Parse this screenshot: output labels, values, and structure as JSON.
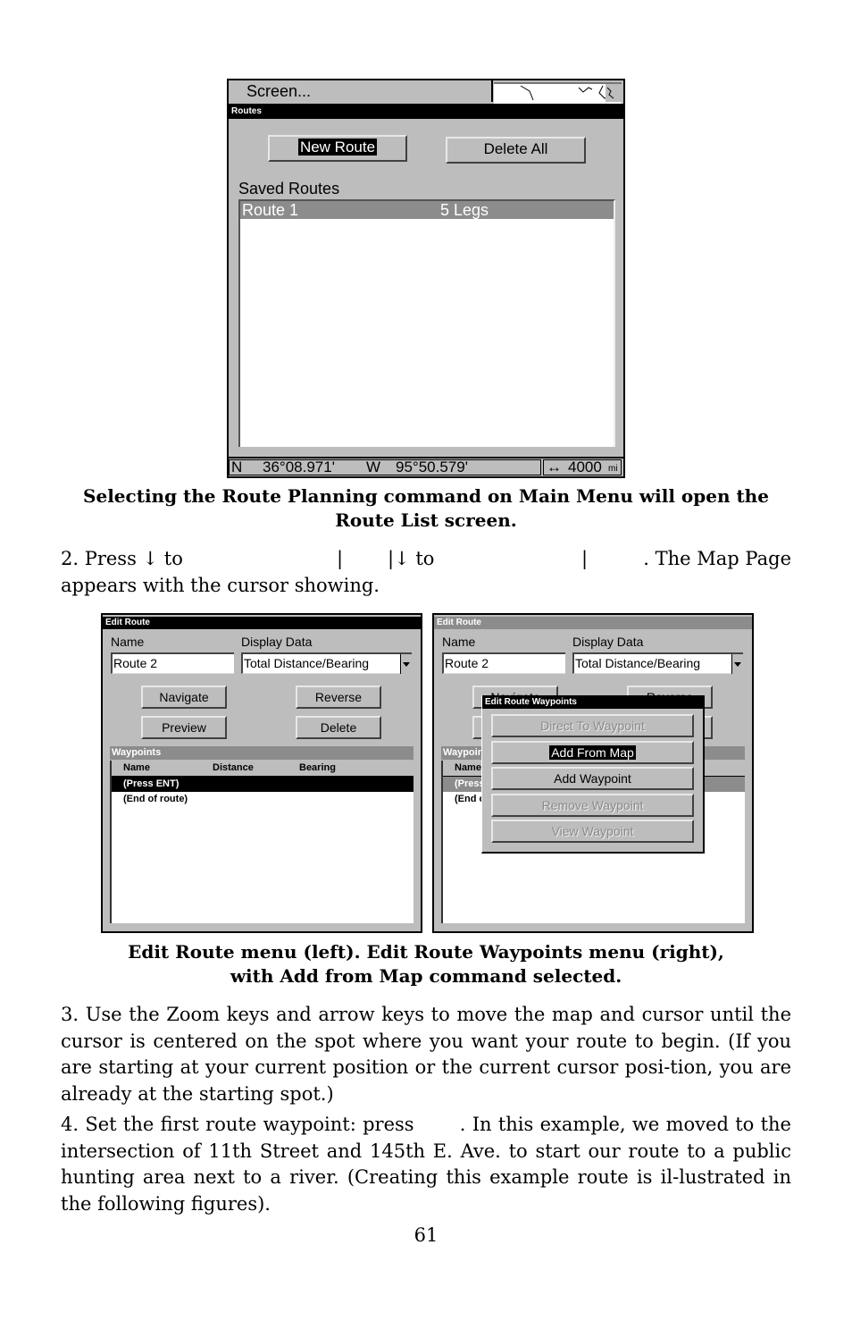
{
  "routes_screen": {
    "top_menu": "Screen...",
    "title": "Routes",
    "buttons": {
      "new_route": "New Route",
      "delete_all": "Delete All"
    },
    "saved_routes_label": "Saved Routes",
    "routes": [
      {
        "name": "Route 1",
        "legs": "5 Legs"
      }
    ],
    "status": {
      "lat_hemi": "N",
      "lat": "36°08.971'",
      "lon_hemi": "W",
      "lon": "95°50.579'",
      "scale_icon": "↔",
      "scale": "4000",
      "scale_unit": "mi"
    }
  },
  "caption1": {
    "line1": "Selecting the Route Planning command on Main Menu will open the",
    "line2": "Route List screen."
  },
  "step2": {
    "part1": "2. Press ↓ to",
    "sep1": "|",
    "part2": "|↓ to",
    "sep2": "|",
    "part3": ". The Map Page",
    "line2": "appears with the cursor showing."
  },
  "edit_route_left": {
    "title": "Edit Route",
    "name_label": "Name",
    "name_value": "Route 2",
    "display_label": "Display Data",
    "display_value": "Total Distance/Bearing",
    "buttons": {
      "navigate": "Navigate",
      "reverse": "Reverse",
      "preview": "Preview",
      "delete": "Delete"
    },
    "waypoints_header": "Waypoints",
    "columns": [
      "Name",
      "Distance",
      "Bearing"
    ],
    "rows": [
      "(Press ENT)",
      "(End of route)"
    ]
  },
  "edit_route_right": {
    "title": "Edit Route",
    "name_label": "Name",
    "name_value": "Route 2",
    "display_label": "Display Data",
    "display_value": "Total Distance/Bearing",
    "buttons": {
      "navigate": "Navigate",
      "reverse": "Reverse"
    },
    "waypoints_header": "Waypoints",
    "columns": [
      "Name"
    ],
    "rows": [
      "(Press ENT)",
      "(End of route)"
    ],
    "popup": {
      "title": "Edit Route Waypoints",
      "items": [
        {
          "label": "Direct To Waypoint",
          "state": "disabled"
        },
        {
          "label": "Add From Map",
          "state": "selected"
        },
        {
          "label": "Add Waypoint",
          "state": "enabled"
        },
        {
          "label": "Remove Waypoint",
          "state": "disabled"
        },
        {
          "label": "View Waypoint",
          "state": "disabled"
        }
      ]
    }
  },
  "caption2": {
    "line1": "Edit Route menu (left). Edit Route Waypoints menu (right),",
    "line2": "with Add from Map command selected."
  },
  "step3": "3. Use the Zoom keys and arrow keys to move the map and cursor until the cursor is centered on the spot where you want your route to begin. (If you are starting at your current position or the current cursor posi-tion, you are already at the starting spot.)",
  "step4": "4. Set the first route waypoint: press       . In this example, we moved to the intersection of 11th Street and 145th E. Ave. to start our route to a public hunting area next to a river. (Creating this example route is il-lustrated in the following figures).",
  "page_number": "61"
}
